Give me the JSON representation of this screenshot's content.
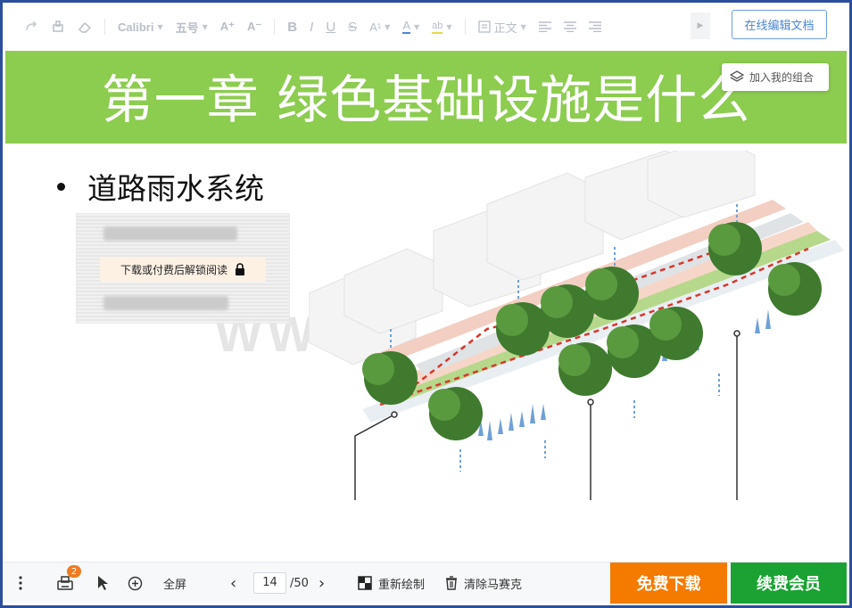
{
  "toolbar": {
    "font_name": "Calibri",
    "font_size": "五号",
    "paragraph_style": "正文",
    "edit_online_label": "在线编辑文档",
    "icons": [
      "redo-icon",
      "format-painter-icon",
      "eraser-icon",
      "increase-font-icon",
      "decrease-font-icon",
      "bold-icon",
      "italic-icon",
      "underline-icon",
      "strikethrough-icon",
      "superscript-icon",
      "font-color-icon",
      "highlight-icon",
      "paragraph-style-icon",
      "align-left-icon",
      "align-center-icon",
      "align-right-icon",
      "scroll-right-icon"
    ]
  },
  "slide": {
    "title": "第一章 绿色基础设施是什么",
    "add_to_combo_label": "加入我的组合",
    "bullet": "道路雨水系统",
    "unlock_label": "下载或付费后解锁阅读",
    "watermark": "WW",
    "title_bg_color": "#8ccc4f"
  },
  "bottom": {
    "badge_count": "2",
    "fullscreen_label": "全屏",
    "current_page": "14",
    "total_pages": "/50",
    "redraw_label": "重新绘制",
    "clear_mosaic_label": "清除马赛克",
    "download_label": "免费下载",
    "vip_label": "续费会员",
    "download_color": "#f57a00",
    "vip_color": "#1aa333"
  }
}
